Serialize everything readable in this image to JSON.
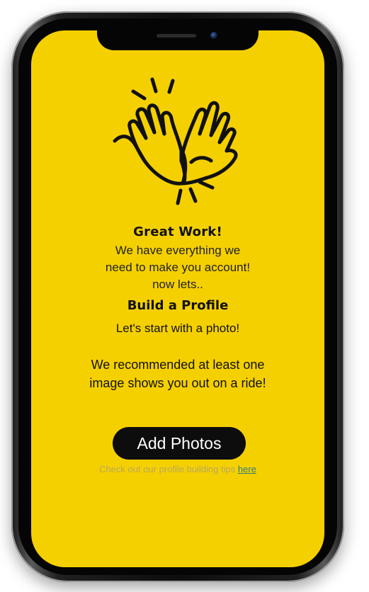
{
  "screen": {
    "background_color": "#f5d000",
    "icon": "high-five-icon",
    "headline": "Great Work!",
    "intro_lines": [
      "We have everything we",
      "need to make you account!",
      "now lets.."
    ],
    "section_title": "Build a Profile",
    "photo_prompt": "Let's start with a photo!",
    "recommendation_lines": [
      "We recommended at least one",
      "image shows you out on a ride!"
    ],
    "add_photos_label": "Add Photos",
    "tips_text": "Check out our profile building tips",
    "tips_link": "here"
  }
}
